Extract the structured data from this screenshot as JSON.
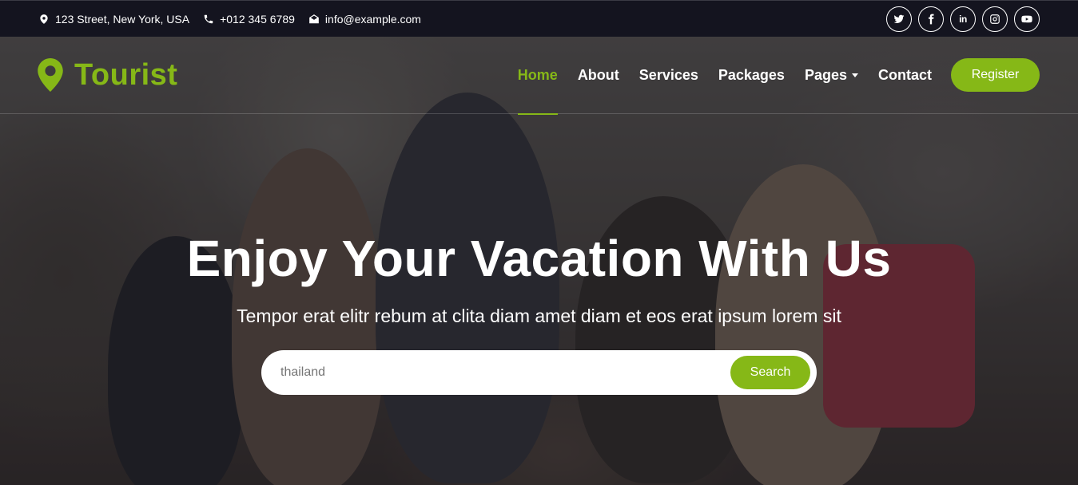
{
  "topbar": {
    "address": "123 Street, New York, USA",
    "phone": "+012 345 6789",
    "email": "info@example.com",
    "socials": [
      {
        "icon": "twitter-icon"
      },
      {
        "icon": "facebook-icon"
      },
      {
        "icon": "linkedin-icon",
        "glyph": "in"
      },
      {
        "icon": "instagram-icon"
      },
      {
        "icon": "youtube-icon"
      }
    ]
  },
  "navbar": {
    "brand": "Tourist",
    "menu": [
      {
        "label": "Home",
        "active": true
      },
      {
        "label": "About"
      },
      {
        "label": "Services"
      },
      {
        "label": "Packages"
      },
      {
        "label": "Pages",
        "dropdown": true
      },
      {
        "label": "Contact"
      }
    ],
    "register_label": "Register"
  },
  "hero": {
    "title": "Enjoy Your Vacation With Us",
    "subtitle": "Tempor erat elitr rebum at clita diam amet diam et eos erat ipsum lorem sit",
    "search": {
      "value": "thailand",
      "button_label": "Search"
    }
  },
  "colors": {
    "accent": "#86b817",
    "topbar_bg": "#14141f"
  }
}
